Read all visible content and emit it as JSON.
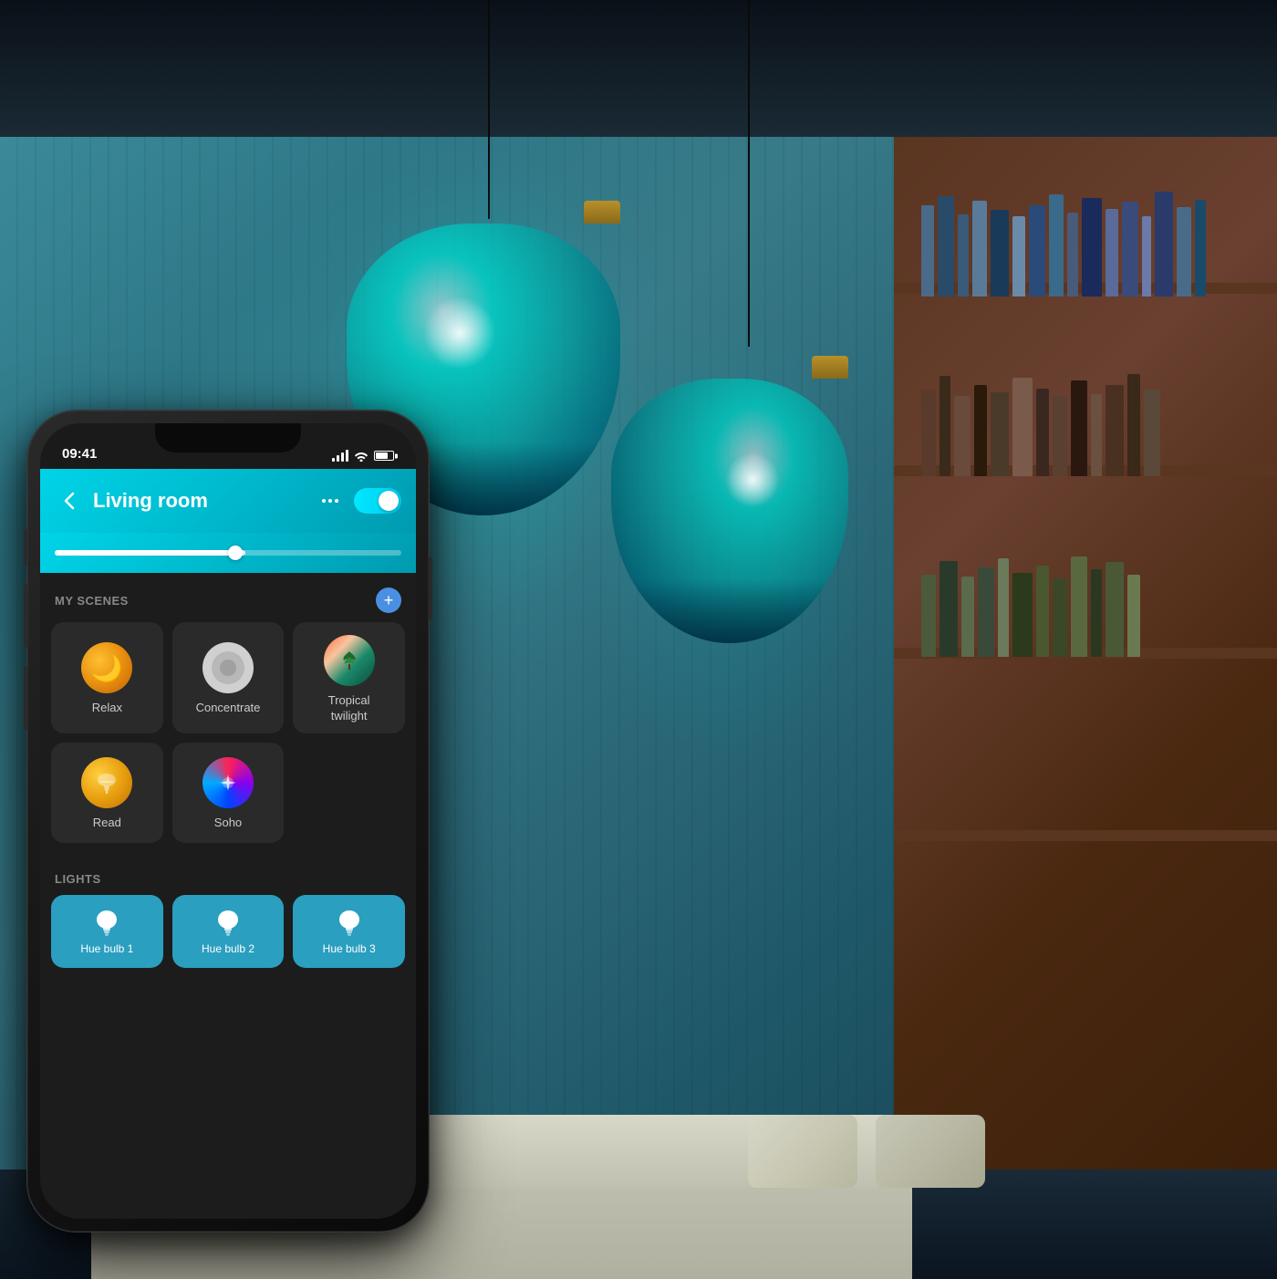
{
  "scene": {
    "bg_description": "Living room with teal pendant lamps"
  },
  "phone": {
    "status_bar": {
      "time": "09:41",
      "signal_label": "signal",
      "wifi_label": "wifi",
      "battery_label": "battery"
    },
    "header": {
      "back_label": "‹",
      "title": "Living room",
      "more_label": "...",
      "toggle_state": "on"
    },
    "slider": {
      "brightness_label": "brightness",
      "value": 55
    },
    "scenes_section": {
      "title": "MY SCENES",
      "add_label": "+",
      "items": [
        {
          "id": "relax",
          "label": "Relax",
          "icon_type": "moon"
        },
        {
          "id": "concentrate",
          "label": "Concentrate",
          "icon_type": "rings"
        },
        {
          "id": "tropical_twilight",
          "label": "Tropical twilight",
          "icon_type": "photo"
        },
        {
          "id": "read",
          "label": "Read",
          "icon_type": "lamp"
        },
        {
          "id": "soho",
          "label": "Soho",
          "icon_type": "conic"
        }
      ]
    },
    "lights_section": {
      "title": "LIGHTS",
      "items": [
        {
          "label": "Hue bulb 1"
        },
        {
          "label": "Hue bulb 2"
        },
        {
          "label": "Hue bulb 3"
        }
      ]
    }
  },
  "colors": {
    "accent_teal": "#00d4e8",
    "phone_bg": "#1c1c1c",
    "scene_card_bg": "#2a2a2a",
    "light_card_bg": "#2a9fc0"
  }
}
